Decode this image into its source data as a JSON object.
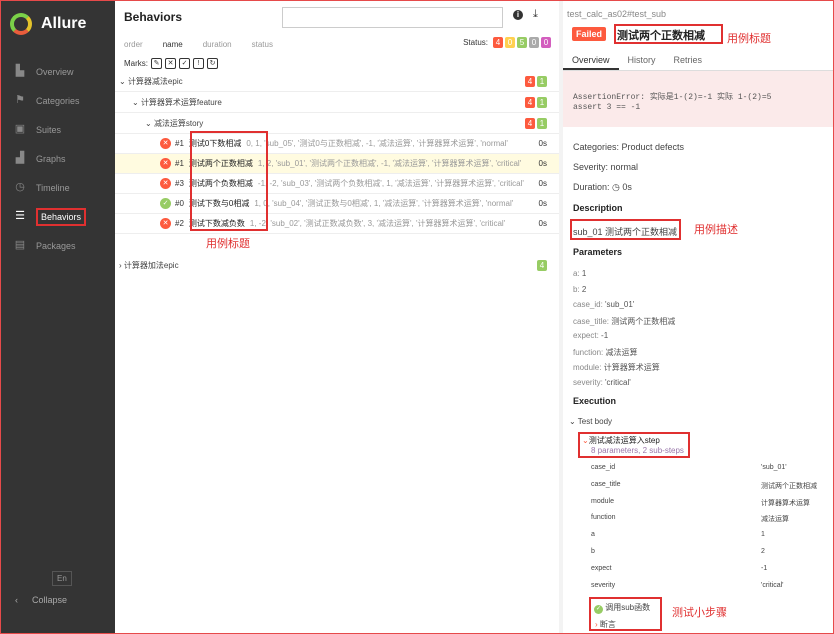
{
  "app": {
    "logo_text": "Allure"
  },
  "sidebar": {
    "items": [
      {
        "label": "Overview",
        "icon": "overview-icon",
        "glyph": "▙"
      },
      {
        "label": "Categories",
        "icon": "categories-icon",
        "glyph": "⚑"
      },
      {
        "label": "Suites",
        "icon": "suites-icon",
        "glyph": "▣"
      },
      {
        "label": "Graphs",
        "icon": "graphs-icon",
        "glyph": "▟"
      },
      {
        "label": "Timeline",
        "icon": "timeline-icon",
        "glyph": "◷"
      },
      {
        "label": "Behaviors",
        "icon": "behaviors-icon",
        "glyph": "☰"
      },
      {
        "label": "Packages",
        "icon": "packages-icon",
        "glyph": "▤"
      }
    ],
    "active": "Behaviors",
    "lang": "En",
    "collapse": "Collapse"
  },
  "middle": {
    "title": "Behaviors",
    "sort": {
      "order": "order",
      "name": "name",
      "duration": "duration",
      "status": "status"
    },
    "status_label": "Status:",
    "status_counts": {
      "failed": "4",
      "broken": "0",
      "passed": "5",
      "skipped": "0",
      "unknown": "0"
    },
    "marks_label": "Marks:",
    "epic1": {
      "label": "计算器减法epic",
      "failed": "4",
      "passed": "1"
    },
    "feature1": {
      "label": "计算器算术运算feature",
      "failed": "4",
      "passed": "1"
    },
    "story1": {
      "label": "减法运算story",
      "failed": "4",
      "passed": "1"
    },
    "tests": [
      {
        "num": "#1",
        "name": "测试0下数相减",
        "params": "0, 1, 'sub_05', '测试0与正数相减', -1, '减法运算', '计算器算术运算', 'normal'",
        "duration": "0s",
        "status": "failed"
      },
      {
        "num": "#1",
        "name": "测试两个正数相减",
        "params": "1, 2, 'sub_01', '测试两个正数相减', -1, '减法运算', '计算器算术运算', 'critical'",
        "duration": "0s",
        "status": "failed"
      },
      {
        "num": "#3",
        "name": "测试两个负数相减",
        "params": "-1, -2, 'sub_03', '测试两个负数相减', 1, '减法运算', '计算器算术运算', 'critical'",
        "duration": "0s",
        "status": "failed"
      },
      {
        "num": "#0",
        "name": "测试下数与0相减",
        "params": "1, 0, 'sub_04', '测试正数与0相减', 1, '减法运算', '计算器算术运算', 'normal'",
        "duration": "0s",
        "status": "passed"
      },
      {
        "num": "#2",
        "name": "测试下数减负数",
        "params": "1, -2, 'sub_02', '测试正数减负数', 3, '减法运算', '计算器算术运算', 'critical'",
        "duration": "0s",
        "status": "failed"
      }
    ],
    "epic2": {
      "label": "计算器加法epic",
      "passed": "4"
    },
    "annotation": "用例标题"
  },
  "right": {
    "path": "test_calc_as02#test_sub",
    "badge": "Failed",
    "title": "测试两个正数相减",
    "title_annotation": "用例标题",
    "tabs": [
      "Overview",
      "History",
      "Retries"
    ],
    "error_line1": "AssertionError: 实际是1-(2)=-1 实际 1-(2)=5",
    "error_line2": "assert 3 == -1",
    "categories": "Categories: Product defects",
    "severity": "Severity: normal",
    "duration": "Duration: ◷ 0s",
    "description_h": "Description",
    "description": "sub_01 测试两个正数相减",
    "description_annotation": "用例描述",
    "parameters_h": "Parameters",
    "params": [
      {
        "k": "a:",
        "v": "1"
      },
      {
        "k": "b:",
        "v": "2"
      },
      {
        "k": "case_id:",
        "v": "'sub_01'"
      },
      {
        "k": "case_title:",
        "v": "测试两个正数相减"
      },
      {
        "k": "expect:",
        "v": "-1"
      },
      {
        "k": "function:",
        "v": "减法运算"
      },
      {
        "k": "module:",
        "v": "计算器算术运算"
      },
      {
        "k": "severity:",
        "v": "'critical'"
      }
    ],
    "execution_h": "Execution",
    "test_body": "Test body",
    "step": "测试减法运算入step",
    "step_sub": "8 parameters, 2 sub-steps",
    "kv": [
      {
        "k": "case_id",
        "v": "'sub_01'"
      },
      {
        "k": "case_title",
        "v": "测试两个正数相减"
      },
      {
        "k": "module",
        "v": "计算器算术运算"
      },
      {
        "k": "function",
        "v": "减法运算"
      },
      {
        "k": "a",
        "v": "1"
      },
      {
        "k": "b",
        "v": "2"
      },
      {
        "k": "expect",
        "v": "-1"
      },
      {
        "k": "severity",
        "v": "'critical'"
      }
    ],
    "substep1": "调用sub函数",
    "substep2": "断言",
    "substep_annotation": "测试小步骤"
  }
}
